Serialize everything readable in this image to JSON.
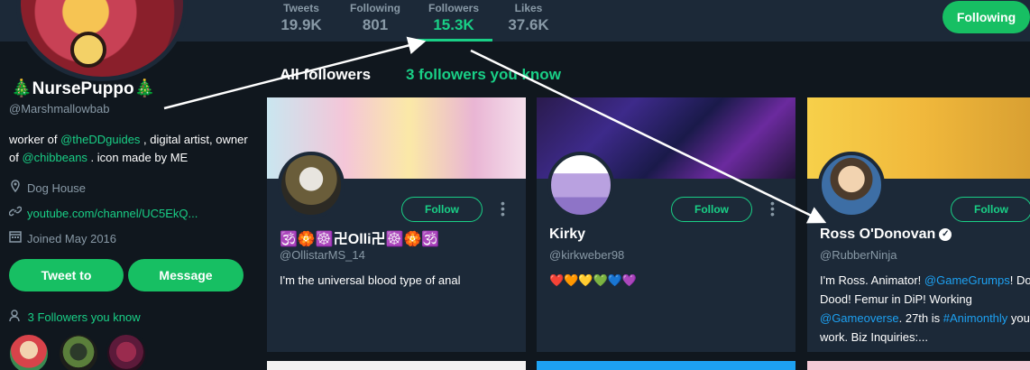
{
  "stats": [
    {
      "label": "Tweets",
      "value": "19.9K"
    },
    {
      "label": "Following",
      "value": "801"
    },
    {
      "label": "Followers",
      "value": "15.3K"
    },
    {
      "label": "Likes",
      "value": "37.6K"
    }
  ],
  "header": {
    "following_button": "Following"
  },
  "profile": {
    "name": "🎄NursePuppo🎄",
    "handle": "@Marshmallowbab",
    "bio": {
      "part1": "worker of ",
      "link1": "@theDDguides",
      "part2": " , digital artist, owner of ",
      "link2": "@chibbeans",
      "part3": " . icon made by ME"
    },
    "location": "Dog House",
    "website": "youtube.com/channel/UC5EkQ...",
    "joined": "Joined May 2016",
    "tweet_to": "Tweet to",
    "message": "Message",
    "followers_you_know": "3 Followers you know"
  },
  "tabs": {
    "all": "All followers",
    "know": "3 followers you know"
  },
  "cards": [
    {
      "name": "🕉️🏵️☸️卍Olli卍☸️🏵️🕉️",
      "handle": "@OllistarMS_14",
      "bio": "I'm the universal blood type of anal",
      "follow": "Follow"
    },
    {
      "name": "Kirky",
      "handle": "@kirkweber98",
      "bio": "❤️🧡💛💚💙💜",
      "follow": "Follow"
    },
    {
      "name": "Ross O'Donovan",
      "handle": "@RubberNinja",
      "bio_parts": {
        "p1": "I'm Ross. Animator! ",
        "l1": "@GameGrumps",
        "p2": "! Doodle Dood! Femur in DiP! Working ",
        "l2": "@Gameoverse",
        "p3": ". 27th is ",
        "l3": "#Animonthly",
        "p4": " your work. Biz Inquiries:..."
      },
      "follow": "Follow"
    }
  ],
  "colors": {
    "accent": "#19cf86",
    "background": "#10171e",
    "card": "#1c2938",
    "muted": "#8899a6",
    "link_blue": "#1da1f2"
  },
  "icons": {
    "location": "map-pin-icon",
    "website": "link-icon",
    "joined": "calendar-icon",
    "people": "person-icon",
    "verified": "verified-badge-icon",
    "more": "more-dots-icon"
  }
}
